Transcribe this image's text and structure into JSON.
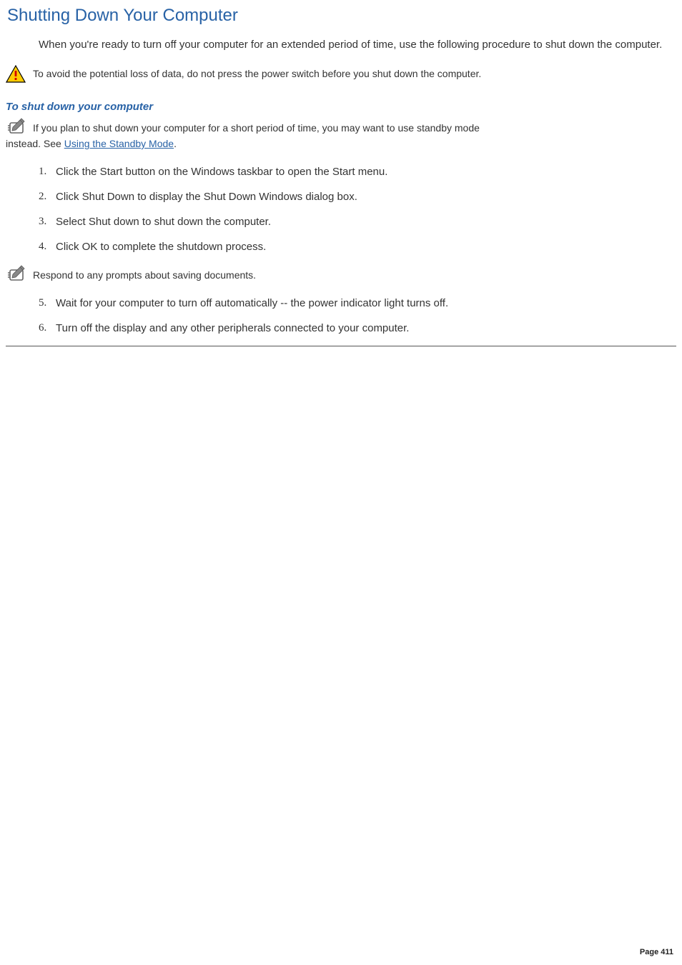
{
  "title": "Shutting Down Your Computer",
  "intro": "When you're ready to turn off your computer for an extended period of time, use the following procedure to shut down the computer.",
  "warning": "To avoid the potential loss of data, do not press the power switch before you shut down the computer.",
  "subheading": "To shut down your computer",
  "note1_line1": "If you plan to shut down your computer for a short period of time, you may want to use standby mode",
  "note1_line2_prefix": "instead. See ",
  "note1_link": "Using the Standby Mode",
  "note1_line2_suffix": ".",
  "steps_a": [
    "Click the Start button on the Windows taskbar to open the Start menu.",
    "Click Shut Down to display the Shut Down Windows dialog box.",
    "Select Shut down to shut down the computer.",
    "Click OK to complete the shutdown process."
  ],
  "mid_note": "Respond to any prompts about saving documents.",
  "steps_b": [
    "Wait for your computer to turn off automatically -- the power indicator light turns off.",
    "Turn off the display and any other peripherals connected to your computer."
  ],
  "page_number": "Page 411"
}
